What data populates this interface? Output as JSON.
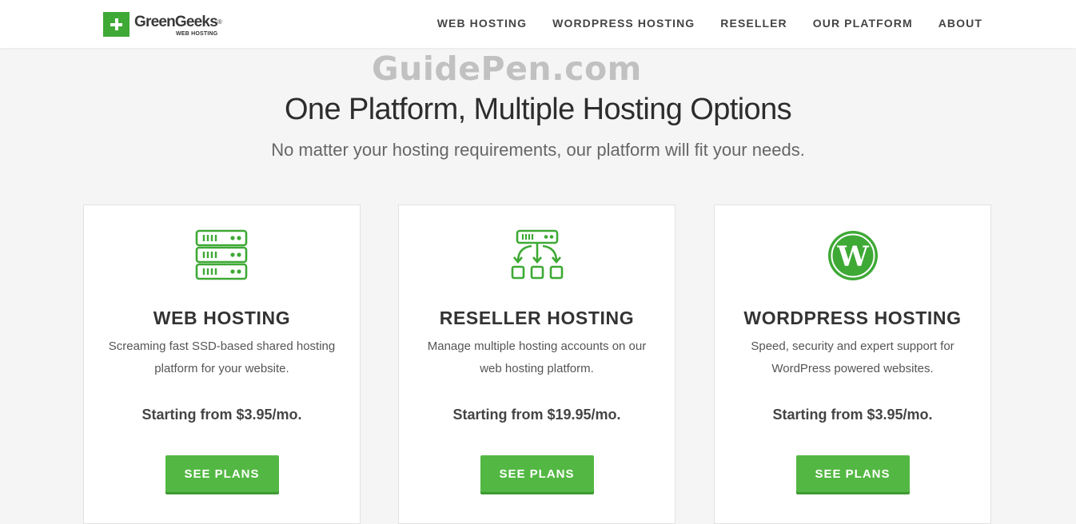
{
  "brand": {
    "name": "GreenGeeks",
    "trademark": "®",
    "tagline": "WEB HOSTING",
    "color": "#3ea935"
  },
  "nav": {
    "items": [
      "WEB HOSTING",
      "WORDPRESS HOSTING",
      "RESELLER",
      "OUR PLATFORM",
      "ABOUT"
    ]
  },
  "watermark": "GuidePen.com",
  "hero": {
    "title": "One Platform, Multiple Hosting Options",
    "subtitle": "No matter your hosting requirements, our platform will fit your needs."
  },
  "cards": [
    {
      "icon": "server-stack-icon",
      "title": "WEB HOSTING",
      "description": "Screaming fast SSD-based shared hosting platform for your website.",
      "price": "Starting from $3.95/mo.",
      "button": "SEE PLANS"
    },
    {
      "icon": "reseller-network-icon",
      "title": "RESELLER HOSTING",
      "description": "Manage multiple hosting accounts on our web hosting platform.",
      "price": "Starting from $19.95/mo.",
      "button": "SEE PLANS"
    },
    {
      "icon": "wordpress-icon",
      "title": "WORDPRESS HOSTING",
      "description": "Speed, security and expert support for WordPress powered websites.",
      "price": "Starting from $3.95/mo.",
      "button": "SEE PLANS"
    }
  ],
  "colors": {
    "accent": "#53b843",
    "icon": "#3ea935"
  }
}
